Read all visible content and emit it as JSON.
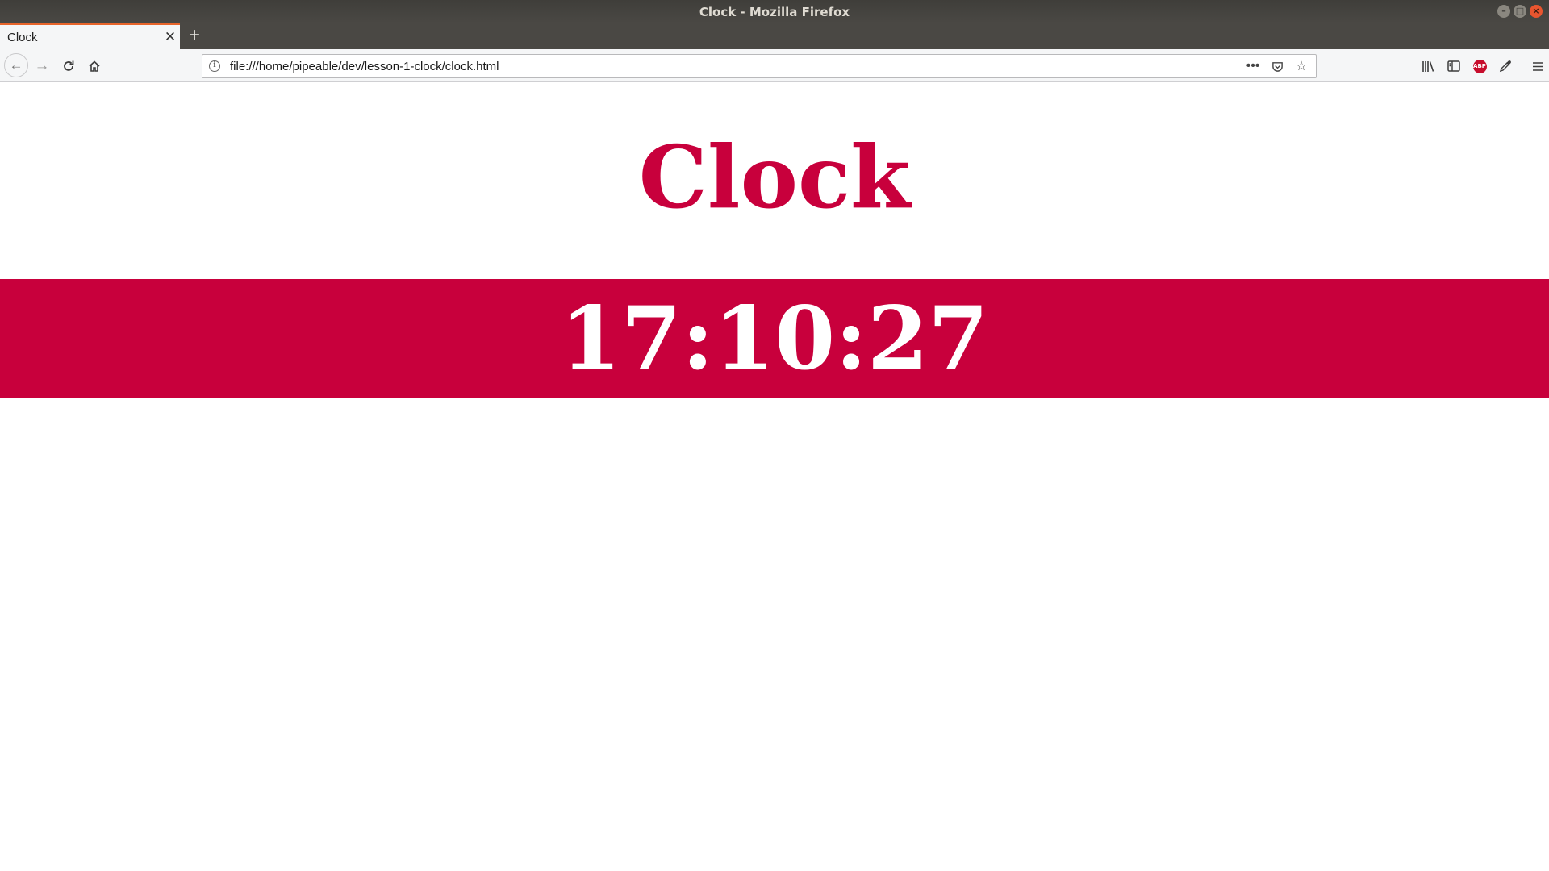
{
  "window": {
    "title": "Clock - Mozilla Firefox"
  },
  "tabs": [
    {
      "label": "Clock",
      "active": true
    }
  ],
  "navbar": {
    "url": "file:///home/pipeable/dev/lesson-1-clock/clock.html",
    "icons": [
      "back-icon",
      "forward-icon",
      "reload-icon",
      "home-icon",
      "page-info-icon",
      "page-actions-icon",
      "pocket-icon",
      "bookmark-star-icon",
      "library-icon",
      "sidebar-icon",
      "adblock-plus-icon",
      "eyedropper-icon",
      "menu-icon"
    ],
    "abp_label": "ABP"
  },
  "page": {
    "heading": "Clock",
    "time": "17:10:27",
    "accent_color": "#c8003c"
  }
}
